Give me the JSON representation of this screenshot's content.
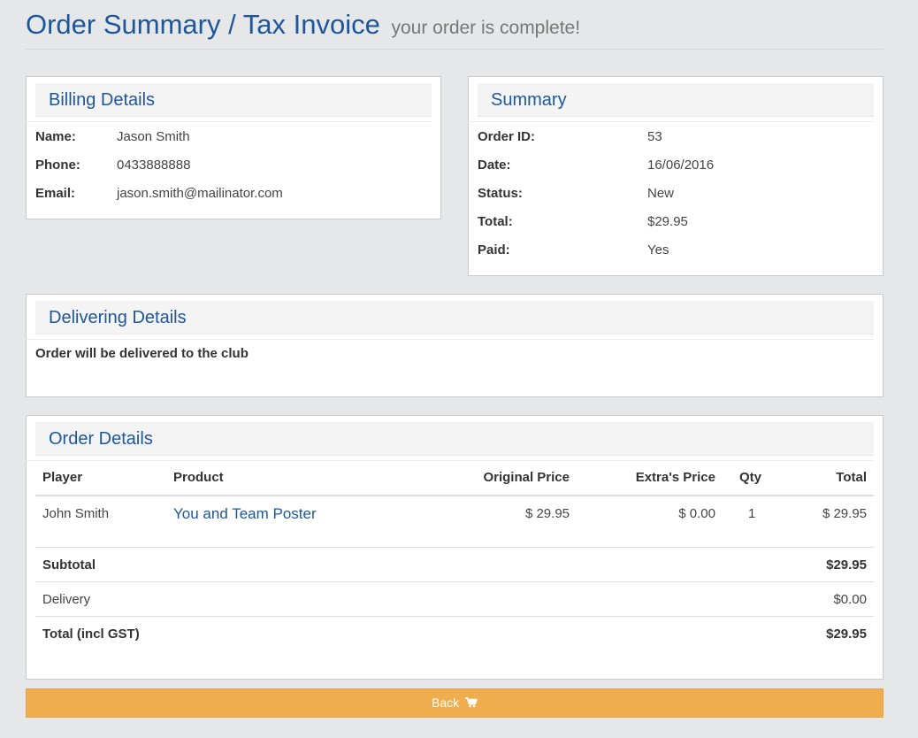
{
  "header": {
    "title": "Order Summary / Tax Invoice",
    "subtitle": "your order is complete!"
  },
  "billing": {
    "heading": "Billing Details",
    "rows": [
      {
        "label": "Name:",
        "value": "Jason Smith"
      },
      {
        "label": "Phone:",
        "value": "0433888888"
      },
      {
        "label": "Email:",
        "value": "jason.smith@mailinator.com"
      }
    ]
  },
  "summary": {
    "heading": "Summary",
    "rows": [
      {
        "label": "Order ID:",
        "value": "53"
      },
      {
        "label": "Date:",
        "value": "16/06/2016"
      },
      {
        "label": "Status:",
        "value": "New"
      },
      {
        "label": "Total:",
        "value": "$29.95"
      },
      {
        "label": "Paid:",
        "value": "Yes"
      }
    ]
  },
  "delivering": {
    "heading": "Delivering Details",
    "text": "Order will be delivered to the club"
  },
  "order": {
    "heading": "Order Details",
    "columns": {
      "player": "Player",
      "product": "Product",
      "original_price": "Original Price",
      "extras_price": "Extra's Price",
      "qty": "Qty",
      "total": "Total"
    },
    "items": [
      {
        "player": "John Smith",
        "product": "You and Team Poster",
        "original_price": "$ 29.95",
        "extras_price": "$ 0.00",
        "qty": "1",
        "total": "$ 29.95"
      }
    ],
    "totals": [
      {
        "label": "Subtotal",
        "value": "$29.95",
        "bold": true
      },
      {
        "label": "Delivery",
        "value": "$0.00",
        "bold": false
      },
      {
        "label": "Total (incl GST)",
        "value": "$29.95",
        "bold": true
      }
    ]
  },
  "back_button": {
    "label": "Back",
    "icon": "shopping-cart-icon",
    "color": "#f0ad4e"
  }
}
